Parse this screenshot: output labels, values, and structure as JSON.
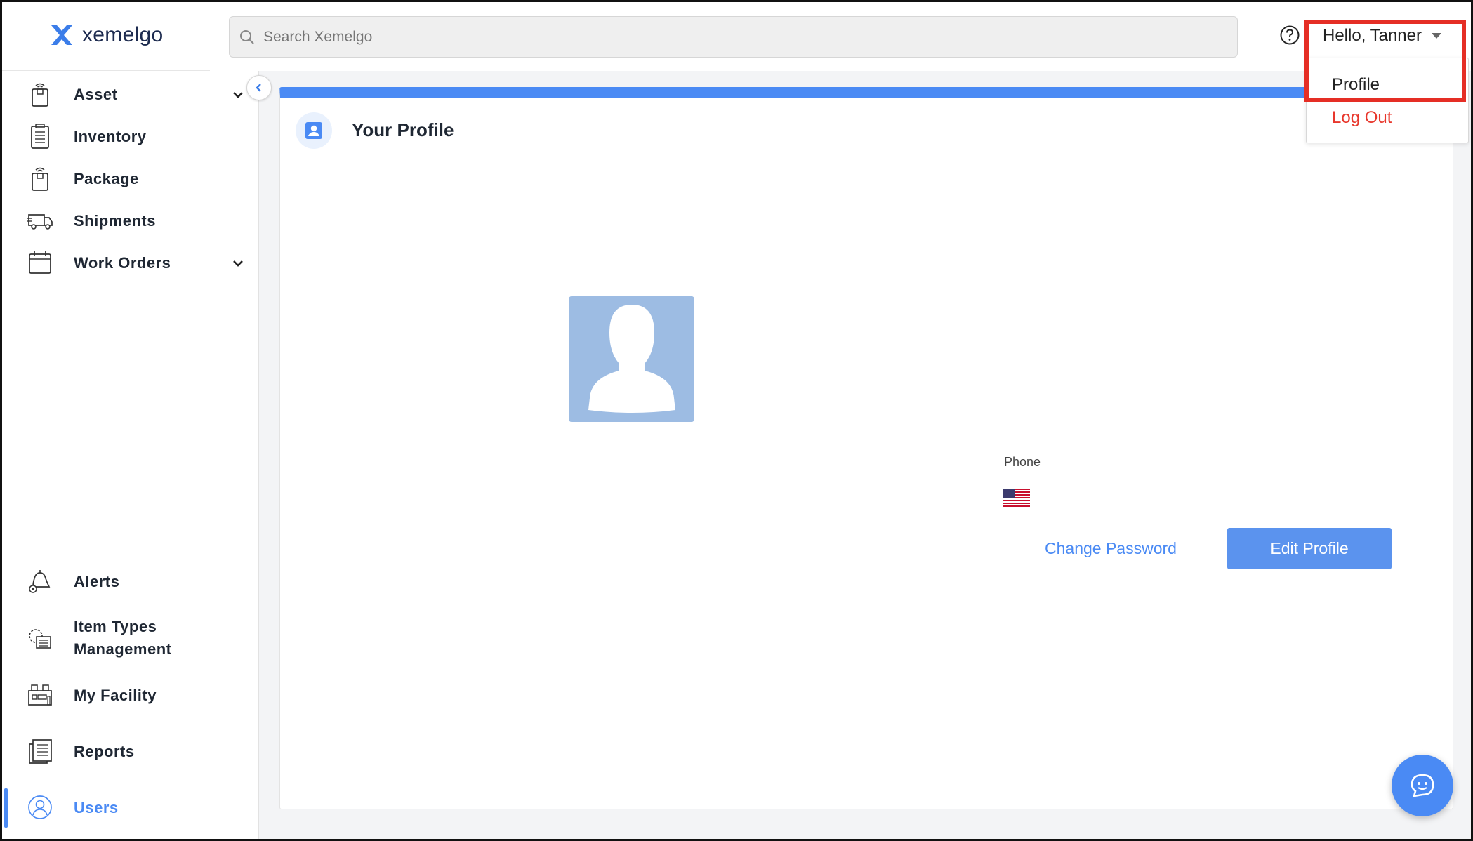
{
  "brand": {
    "name": "xemelgo"
  },
  "search": {
    "placeholder": "Search Xemelgo"
  },
  "user_menu": {
    "greeting": "Hello, Tanner"
  },
  "dropdown": {
    "items": [
      {
        "label": "Profile"
      },
      {
        "label": "Log Out"
      }
    ]
  },
  "sidebar": {
    "items": [
      {
        "label": "Asset",
        "icon": "asset-icon",
        "has_submenu": true
      },
      {
        "label": "Inventory",
        "icon": "clipboard-icon"
      },
      {
        "label": "Package",
        "icon": "package-icon"
      },
      {
        "label": "Shipments",
        "icon": "truck-icon"
      },
      {
        "label": "Work Orders",
        "icon": "calendar-icon",
        "has_submenu": true
      },
      {
        "label": "Alerts",
        "icon": "bell-icon"
      },
      {
        "label": "Item Types Management",
        "icon": "item-types-icon"
      },
      {
        "label": "My Facility",
        "icon": "facility-icon"
      },
      {
        "label": "Reports",
        "icon": "reports-icon"
      },
      {
        "label": "Users",
        "icon": "users-icon",
        "active": true
      }
    ]
  },
  "profile": {
    "title": "Your Profile",
    "phone_label": "Phone",
    "change_password_label": "Change Password",
    "edit_profile_label": "Edit Profile"
  },
  "colors": {
    "accent": "#4a8af4",
    "logout": "#e8372c",
    "highlight": "#e52e25",
    "avatar_bg": "#9dbce3"
  }
}
